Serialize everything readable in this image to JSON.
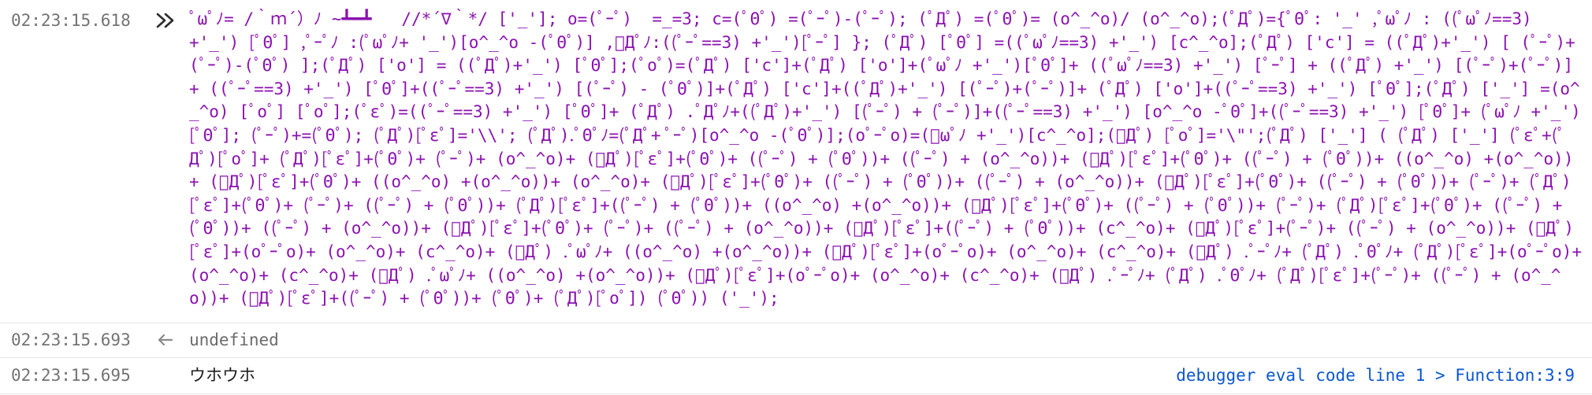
{
  "entries": [
    {
      "type": "input",
      "timestamp": "02:23:15.618",
      "icon": "double-chevron-right-icon",
      "code": "ﾟωﾟﾉ= /｀ｍ´）ﾉ ~┻━┻   //*´∇｀*/ ['_']; o=(ﾟｰﾟ)  =_=3; c=(ﾟΘﾟ) =(ﾟｰﾟ)-(ﾟｰﾟ); (ﾟДﾟ) =(ﾟΘﾟ)= (o^_^o)/ (o^_^o);(ﾟДﾟ)={ﾟΘﾟ: '_' ,ﾟωﾟﾉ : ((ﾟωﾟﾉ==3) +'_') [ﾟΘﾟ] ,ﾟｰﾟﾉ :(ﾟωﾟﾉ+ '_')[o^_^o -(ﾟΘﾟ)] ,ﾟДﾟﾉ:((ﾟｰﾟ==3) +'_')[ﾟｰﾟ] }; (ﾟДﾟ) [ﾟΘﾟ] =((ﾟωﾟﾉ==3) +'_') [c^_^o];(ﾟДﾟ) ['c'] = ((ﾟДﾟ)+'_') [ (ﾟｰﾟ)+(ﾟｰﾟ)-(ﾟΘﾟ) ];(ﾟДﾟ) ['o'] = ((ﾟДﾟ)+'_') [ﾟΘﾟ];(ﾟoﾟ)=(ﾟДﾟ) ['c']+(ﾟДﾟ) ['o']+(ﾟωﾟﾉ +'_')[ﾟΘﾟ]+ ((ﾟωﾟﾉ==3) +'_') [ﾟｰﾟ] + ((ﾟДﾟ) +'_') [(ﾟｰﾟ)+(ﾟｰﾟ)]+ ((ﾟｰﾟ==3) +'_') [ﾟΘﾟ]+((ﾟｰﾟ==3) +'_') [(ﾟｰﾟ) - (ﾟΘﾟ)]+(ﾟДﾟ) ['c']+((ﾟДﾟ)+'_') [(ﾟｰﾟ)+(ﾟｰﾟ)]+ (ﾟДﾟ) ['o']+((ﾟｰﾟ==3) +'_') [ﾟΘﾟ];(ﾟДﾟ) ['_'] =(o^_^o) [ﾟoﾟ] [ﾟoﾟ];(ﾟεﾟ)=((ﾟｰﾟ==3) +'_') [ﾟΘﾟ]+ (ﾟДﾟ) .ﾟДﾟﾉ+((ﾟДﾟ)+'_') [(ﾟｰﾟ) + (ﾟｰﾟ)]+((ﾟｰﾟ==3) +'_') [o^_^o -ﾟΘﾟ]+((ﾟｰﾟ==3) +'_') [ﾟΘﾟ]+ (ﾟωﾟﾉ +'_') [ﾟΘﾟ]; (ﾟｰﾟ)+=(ﾟΘﾟ); (ﾟДﾟ)[ﾟεﾟ]='\\\\'; (ﾟДﾟ).ﾟΘﾟﾉ=(ﾟДﾟ+ ﾟｰﾟ)[o^_^o -(ﾟΘﾟ)];(oﾟｰﾟo)=(ﾟωﾟﾉ +'_')[c^_^o];(ﾟДﾟ) [ﾟoﾟ]='\\\"';(ﾟДﾟ) ['_'] ( (ﾟДﾟ) ['_'] (ﾟεﾟ+(ﾟДﾟ)[ﾟoﾟ]+ (ﾟДﾟ)[ﾟεﾟ]+(ﾟΘﾟ)+ (ﾟｰﾟ)+ (o^_^o)+ (ﾟДﾟ)[ﾟεﾟ]+(ﾟΘﾟ)+ ((ﾟｰﾟ) + (ﾟΘﾟ))+ ((ﾟｰﾟ) + (o^_^o))+ (ﾟДﾟ)[ﾟεﾟ]+(ﾟΘﾟ)+ ((ﾟｰﾟ) + (ﾟΘﾟ))+ ((o^_^o) +(o^_^o))+ (ﾟДﾟ)[ﾟεﾟ]+(ﾟΘﾟ)+ ((o^_^o) +(o^_^o))+ (o^_^o)+ (ﾟДﾟ)[ﾟεﾟ]+(ﾟΘﾟ)+ ((ﾟｰﾟ) + (ﾟΘﾟ))+ ((ﾟｰﾟ) + (o^_^o))+ (ﾟДﾟ)[ﾟεﾟ]+(ﾟΘﾟ)+ ((ﾟｰﾟ) + (ﾟΘﾟ))+ (ﾟｰﾟ)+ (ﾟДﾟ)[ﾟεﾟ]+(ﾟΘﾟ)+ (ﾟｰﾟ)+ ((ﾟｰﾟ) + (ﾟΘﾟ))+ (ﾟДﾟ)[ﾟεﾟ]+((ﾟｰﾟ) + (ﾟΘﾟ))+ ((o^_^o) +(o^_^o))+ (ﾟДﾟ)[ﾟεﾟ]+(ﾟΘﾟ)+ ((ﾟｰﾟ) + (ﾟΘﾟ))+ (ﾟｰﾟ)+ (ﾟДﾟ)[ﾟεﾟ]+(ﾟΘﾟ)+ ((ﾟｰﾟ) + (ﾟΘﾟ))+ ((ﾟｰﾟ) + (o^_^o))+ (ﾟДﾟ)[ﾟεﾟ]+(ﾟΘﾟ)+ (ﾟｰﾟ)+ ((ﾟｰﾟ) + (o^_^o))+ (ﾟДﾟ)[ﾟεﾟ]+((ﾟｰﾟ) + (ﾟΘﾟ))+ (c^_^o)+ (ﾟДﾟ)[ﾟεﾟ]+(ﾟｰﾟ)+ ((ﾟｰﾟ) + (o^_^o))+ (ﾟДﾟ)[ﾟεﾟ]+(oﾟｰﾟo)+ (o^_^o)+ (c^_^o)+ (ﾟДﾟ) .ﾟωﾟﾉ+ ((o^_^o) +(o^_^o))+ (ﾟДﾟ)[ﾟεﾟ]+(oﾟｰﾟo)+ (o^_^o)+ (c^_^o)+ (ﾟДﾟ) .ﾟｰﾟﾉ+ (ﾟДﾟ) .ﾟΘﾟﾉ+ (ﾟДﾟ)[ﾟεﾟ]+(oﾟｰﾟo)+ (o^_^o)+ (c^_^o)+ (ﾟДﾟ) .ﾟωﾟﾉ+ ((o^_^o) +(o^_^o))+ (ﾟДﾟ)[ﾟεﾟ]+(oﾟｰﾟo)+ (o^_^o)+ (c^_^o)+ (ﾟДﾟ) .ﾟｰﾟﾉ+ (ﾟДﾟ) .ﾟΘﾟﾉ+ (ﾟДﾟ)[ﾟεﾟ]+(ﾟｰﾟ)+ ((ﾟｰﾟ) + (o^_^o))+ (ﾟДﾟ)[ﾟεﾟ]+((ﾟｰﾟ) + (ﾟΘﾟ))+ (ﾟΘﾟ)+ (ﾟДﾟ)[ﾟoﾟ]) (ﾟΘﾟ)) ('_');"
    },
    {
      "type": "output",
      "timestamp": "02:23:15.693",
      "icon": "return-arrow-left-icon",
      "text": "undefined"
    },
    {
      "type": "log",
      "timestamp": "02:23:15.695",
      "text": "ウホウホ",
      "source": "debugger eval code line 1 > Function:3:9"
    }
  ],
  "colors": {
    "timestamp": "#737373",
    "link": "#0b57d0",
    "output": "#6b6b6b",
    "divider": "#e6e6e6"
  }
}
